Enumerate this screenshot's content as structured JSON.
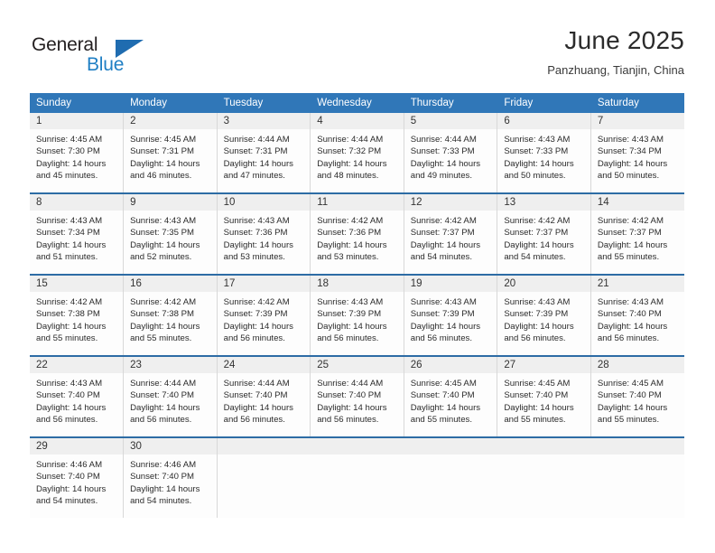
{
  "brand": {
    "name_top": "General",
    "name_bottom": "Blue",
    "triangle_color": "#1f6cb0",
    "blue_color": "#1f7fc4"
  },
  "header": {
    "title": "June 2025",
    "location": "Panzhuang, Tianjin, China"
  },
  "theme": {
    "header_bg": "#3077b8",
    "week_separator": "#2d6ca5",
    "daynum_band": "#efefef",
    "cell_bg": "#fdfdfd",
    "cell_border": "#d8d8d8"
  },
  "weekday_headers": [
    "Sunday",
    "Monday",
    "Tuesday",
    "Wednesday",
    "Thursday",
    "Friday",
    "Saturday"
  ],
  "weeks": [
    [
      {
        "day": "1",
        "sunrise": "Sunrise: 4:45 AM",
        "sunset": "Sunset: 7:30 PM",
        "daylight1": "Daylight: 14 hours",
        "daylight2": "and 45 minutes."
      },
      {
        "day": "2",
        "sunrise": "Sunrise: 4:45 AM",
        "sunset": "Sunset: 7:31 PM",
        "daylight1": "Daylight: 14 hours",
        "daylight2": "and 46 minutes."
      },
      {
        "day": "3",
        "sunrise": "Sunrise: 4:44 AM",
        "sunset": "Sunset: 7:31 PM",
        "daylight1": "Daylight: 14 hours",
        "daylight2": "and 47 minutes."
      },
      {
        "day": "4",
        "sunrise": "Sunrise: 4:44 AM",
        "sunset": "Sunset: 7:32 PM",
        "daylight1": "Daylight: 14 hours",
        "daylight2": "and 48 minutes."
      },
      {
        "day": "5",
        "sunrise": "Sunrise: 4:44 AM",
        "sunset": "Sunset: 7:33 PM",
        "daylight1": "Daylight: 14 hours",
        "daylight2": "and 49 minutes."
      },
      {
        "day": "6",
        "sunrise": "Sunrise: 4:43 AM",
        "sunset": "Sunset: 7:33 PM",
        "daylight1": "Daylight: 14 hours",
        "daylight2": "and 50 minutes."
      },
      {
        "day": "7",
        "sunrise": "Sunrise: 4:43 AM",
        "sunset": "Sunset: 7:34 PM",
        "daylight1": "Daylight: 14 hours",
        "daylight2": "and 50 minutes."
      }
    ],
    [
      {
        "day": "8",
        "sunrise": "Sunrise: 4:43 AM",
        "sunset": "Sunset: 7:34 PM",
        "daylight1": "Daylight: 14 hours",
        "daylight2": "and 51 minutes."
      },
      {
        "day": "9",
        "sunrise": "Sunrise: 4:43 AM",
        "sunset": "Sunset: 7:35 PM",
        "daylight1": "Daylight: 14 hours",
        "daylight2": "and 52 minutes."
      },
      {
        "day": "10",
        "sunrise": "Sunrise: 4:43 AM",
        "sunset": "Sunset: 7:36 PM",
        "daylight1": "Daylight: 14 hours",
        "daylight2": "and 53 minutes."
      },
      {
        "day": "11",
        "sunrise": "Sunrise: 4:42 AM",
        "sunset": "Sunset: 7:36 PM",
        "daylight1": "Daylight: 14 hours",
        "daylight2": "and 53 minutes."
      },
      {
        "day": "12",
        "sunrise": "Sunrise: 4:42 AM",
        "sunset": "Sunset: 7:37 PM",
        "daylight1": "Daylight: 14 hours",
        "daylight2": "and 54 minutes."
      },
      {
        "day": "13",
        "sunrise": "Sunrise: 4:42 AM",
        "sunset": "Sunset: 7:37 PM",
        "daylight1": "Daylight: 14 hours",
        "daylight2": "and 54 minutes."
      },
      {
        "day": "14",
        "sunrise": "Sunrise: 4:42 AM",
        "sunset": "Sunset: 7:37 PM",
        "daylight1": "Daylight: 14 hours",
        "daylight2": "and 55 minutes."
      }
    ],
    [
      {
        "day": "15",
        "sunrise": "Sunrise: 4:42 AM",
        "sunset": "Sunset: 7:38 PM",
        "daylight1": "Daylight: 14 hours",
        "daylight2": "and 55 minutes."
      },
      {
        "day": "16",
        "sunrise": "Sunrise: 4:42 AM",
        "sunset": "Sunset: 7:38 PM",
        "daylight1": "Daylight: 14 hours",
        "daylight2": "and 55 minutes."
      },
      {
        "day": "17",
        "sunrise": "Sunrise: 4:42 AM",
        "sunset": "Sunset: 7:39 PM",
        "daylight1": "Daylight: 14 hours",
        "daylight2": "and 56 minutes."
      },
      {
        "day": "18",
        "sunrise": "Sunrise: 4:43 AM",
        "sunset": "Sunset: 7:39 PM",
        "daylight1": "Daylight: 14 hours",
        "daylight2": "and 56 minutes."
      },
      {
        "day": "19",
        "sunrise": "Sunrise: 4:43 AM",
        "sunset": "Sunset: 7:39 PM",
        "daylight1": "Daylight: 14 hours",
        "daylight2": "and 56 minutes."
      },
      {
        "day": "20",
        "sunrise": "Sunrise: 4:43 AM",
        "sunset": "Sunset: 7:39 PM",
        "daylight1": "Daylight: 14 hours",
        "daylight2": "and 56 minutes."
      },
      {
        "day": "21",
        "sunrise": "Sunrise: 4:43 AM",
        "sunset": "Sunset: 7:40 PM",
        "daylight1": "Daylight: 14 hours",
        "daylight2": "and 56 minutes."
      }
    ],
    [
      {
        "day": "22",
        "sunrise": "Sunrise: 4:43 AM",
        "sunset": "Sunset: 7:40 PM",
        "daylight1": "Daylight: 14 hours",
        "daylight2": "and 56 minutes."
      },
      {
        "day": "23",
        "sunrise": "Sunrise: 4:44 AM",
        "sunset": "Sunset: 7:40 PM",
        "daylight1": "Daylight: 14 hours",
        "daylight2": "and 56 minutes."
      },
      {
        "day": "24",
        "sunrise": "Sunrise: 4:44 AM",
        "sunset": "Sunset: 7:40 PM",
        "daylight1": "Daylight: 14 hours",
        "daylight2": "and 56 minutes."
      },
      {
        "day": "25",
        "sunrise": "Sunrise: 4:44 AM",
        "sunset": "Sunset: 7:40 PM",
        "daylight1": "Daylight: 14 hours",
        "daylight2": "and 56 minutes."
      },
      {
        "day": "26",
        "sunrise": "Sunrise: 4:45 AM",
        "sunset": "Sunset: 7:40 PM",
        "daylight1": "Daylight: 14 hours",
        "daylight2": "and 55 minutes."
      },
      {
        "day": "27",
        "sunrise": "Sunrise: 4:45 AM",
        "sunset": "Sunset: 7:40 PM",
        "daylight1": "Daylight: 14 hours",
        "daylight2": "and 55 minutes."
      },
      {
        "day": "28",
        "sunrise": "Sunrise: 4:45 AM",
        "sunset": "Sunset: 7:40 PM",
        "daylight1": "Daylight: 14 hours",
        "daylight2": "and 55 minutes."
      }
    ],
    [
      {
        "day": "29",
        "sunrise": "Sunrise: 4:46 AM",
        "sunset": "Sunset: 7:40 PM",
        "daylight1": "Daylight: 14 hours",
        "daylight2": "and 54 minutes."
      },
      {
        "day": "30",
        "sunrise": "Sunrise: 4:46 AM",
        "sunset": "Sunset: 7:40 PM",
        "daylight1": "Daylight: 14 hours",
        "daylight2": "and 54 minutes."
      },
      {
        "day": "",
        "sunrise": "",
        "sunset": "",
        "daylight1": "",
        "daylight2": ""
      },
      {
        "day": "",
        "sunrise": "",
        "sunset": "",
        "daylight1": "",
        "daylight2": ""
      },
      {
        "day": "",
        "sunrise": "",
        "sunset": "",
        "daylight1": "",
        "daylight2": ""
      },
      {
        "day": "",
        "sunrise": "",
        "sunset": "",
        "daylight1": "",
        "daylight2": ""
      },
      {
        "day": "",
        "sunrise": "",
        "sunset": "",
        "daylight1": "",
        "daylight2": ""
      }
    ]
  ]
}
